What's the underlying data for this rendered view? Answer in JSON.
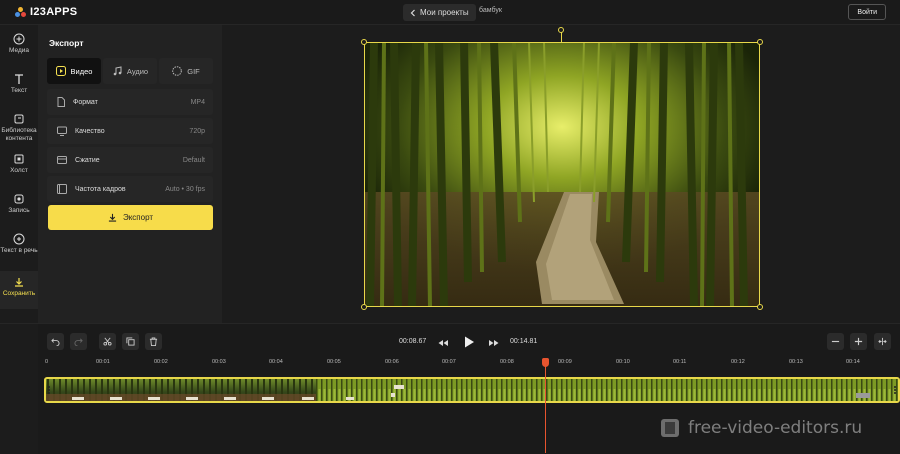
{
  "app": {
    "logo_text": "I23APPS",
    "back_label": "Мои проекты",
    "project_name": "бамбук",
    "login_label": "Войти"
  },
  "sidebar": {
    "items": [
      {
        "label": "Медиа",
        "icon": "plus-circle-icon"
      },
      {
        "label": "Текст",
        "icon": "text-t-icon"
      },
      {
        "label": "Библиотека контента",
        "icon": "library-icon"
      },
      {
        "label": "Холст",
        "icon": "canvas-icon"
      },
      {
        "label": "Запись",
        "icon": "record-icon"
      },
      {
        "label": "Текст в речь",
        "icon": "text-to-speech-icon"
      },
      {
        "label": "Сохранить",
        "icon": "download-icon",
        "active": true
      }
    ]
  },
  "panel": {
    "title": "Экспорт",
    "tabs": [
      {
        "label": "Видео",
        "icon": "video-icon",
        "active": true
      },
      {
        "label": "Аудио",
        "icon": "music-note-icon"
      },
      {
        "label": "GIF",
        "icon": "gif-icon"
      }
    ],
    "settings": [
      {
        "label": "Формат",
        "value": "MP4",
        "icon": "file-icon"
      },
      {
        "label": "Качество",
        "value": "720p",
        "icon": "monitor-icon"
      },
      {
        "label": "Сжатие",
        "value": "Default",
        "icon": "compress-icon"
      },
      {
        "label": "Частота кадров",
        "value": "Auto • 30 fps",
        "icon": "film-icon"
      }
    ],
    "export_label": "Экспорт"
  },
  "timeline": {
    "current_time": "00:08.67",
    "total_time": "00:14.81",
    "ruler": [
      "0",
      "00:01",
      "00:02",
      "00:03",
      "00:04",
      "00:05",
      "00:06",
      "00:07",
      "00:08",
      "00:09",
      "00:10",
      "00:11",
      "00:12",
      "00:13",
      "00:14"
    ]
  },
  "watermark": "free-video-editors.ru",
  "colors": {
    "accent": "#f7dc4a",
    "playhead": "#e8542f",
    "background": "#1a1a1a"
  }
}
